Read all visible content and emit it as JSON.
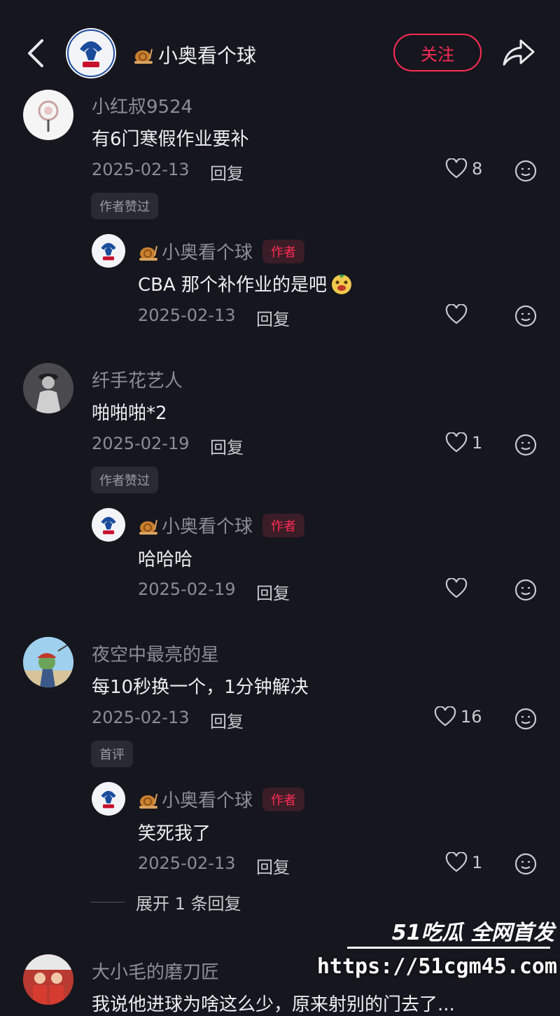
{
  "header": {
    "account_name": "小奥看个球",
    "follow_label": "关注"
  },
  "comments": [
    {
      "user": "小红叔9524",
      "text": "有6门寒假作业要补",
      "date": "2025-02-13",
      "reply_label": "回复",
      "likes": "8",
      "tag": "作者赞过",
      "reply": {
        "user": "小奥看个球",
        "author_tag": "作者",
        "text": "CBA 那个补作业的是吧",
        "date": "2025-02-13",
        "reply_label": "回复",
        "likes": ""
      }
    },
    {
      "user": "纤手花艺人",
      "text": "啪啪啪*2",
      "date": "2025-02-19",
      "reply_label": "回复",
      "likes": "1",
      "tag": "作者赞过",
      "reply": {
        "user": "小奥看个球",
        "author_tag": "作者",
        "text": "哈哈哈",
        "date": "2025-02-19",
        "reply_label": "回复",
        "likes": ""
      }
    },
    {
      "user": "夜空中最亮的星",
      "text": "每10秒换一个，1分钟解决",
      "date": "2025-02-13",
      "reply_label": "回复",
      "likes": "16",
      "tag": "首评",
      "reply": {
        "user": "小奥看个球",
        "author_tag": "作者",
        "text": "笑死我了",
        "date": "2025-02-13",
        "reply_label": "回复",
        "likes": "1"
      },
      "expand_label": "展开 1 条回复"
    },
    {
      "user": "大小毛的磨刀匠",
      "text": "我说他进球为啥这么少，原来射别的门去了..."
    }
  ],
  "watermark": {
    "title": "51吃瓜 全网首发",
    "url": "https://51cgm45.com"
  },
  "colors": {
    "background": "#16161e",
    "accent": "#fe2c55"
  }
}
